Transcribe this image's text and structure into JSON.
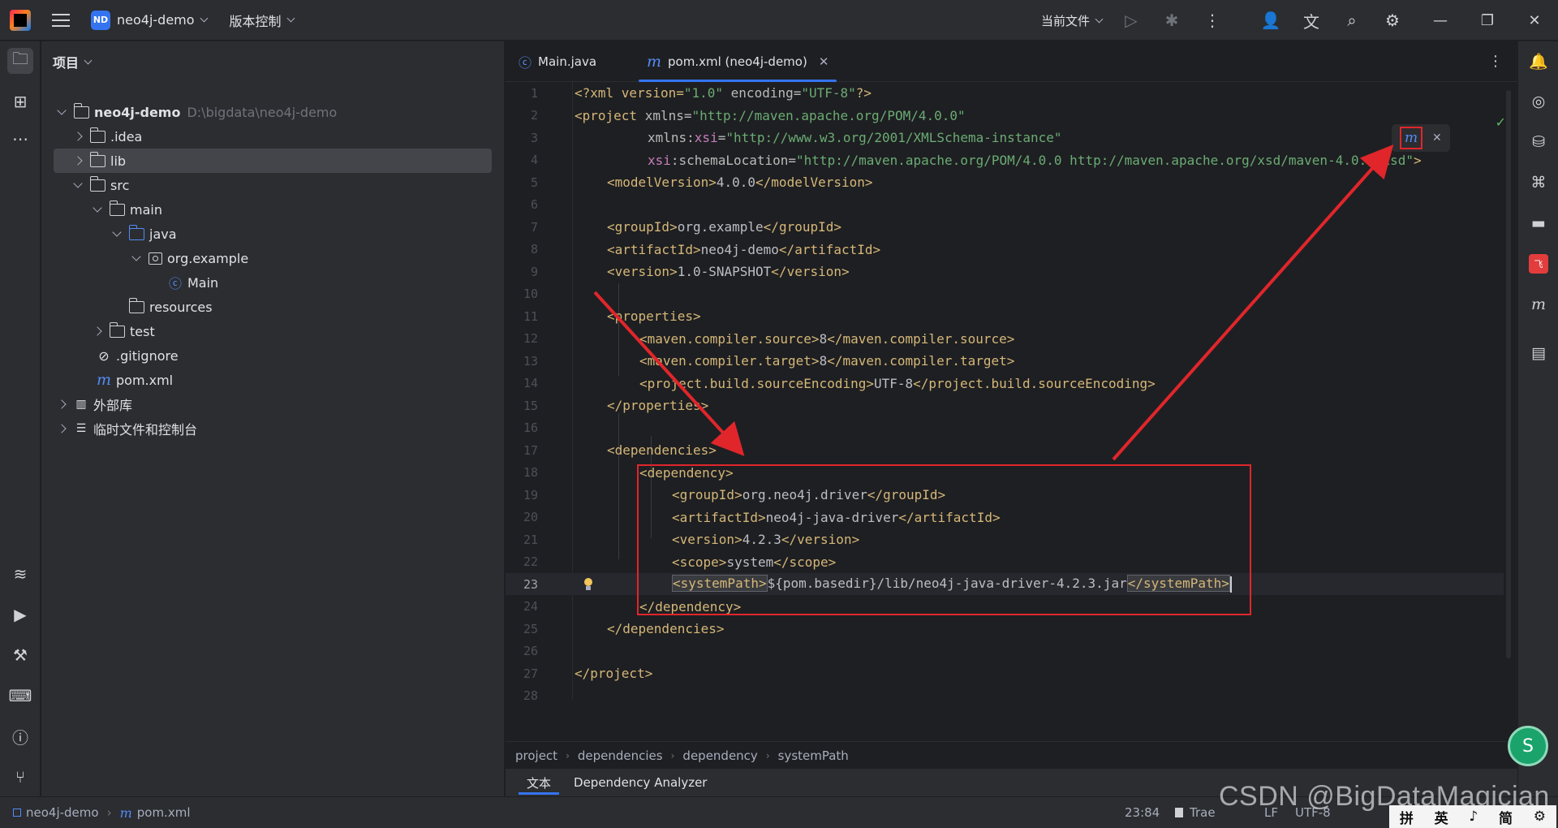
{
  "titlebar": {
    "project_badge": "ND",
    "project_name": "neo4j-demo",
    "vcs_label": "版本控制",
    "run_config": "当前文件"
  },
  "project_panel": {
    "title": "项目",
    "tree": [
      {
        "label": "neo4j-demo",
        "path": "D:\\bigdata\\neo4j-demo"
      },
      {
        "label": ".idea"
      },
      {
        "label": "lib"
      },
      {
        "label": "src"
      },
      {
        "label": "main"
      },
      {
        "label": "java"
      },
      {
        "label": "org.example"
      },
      {
        "label": "Main"
      },
      {
        "label": "resources"
      },
      {
        "label": "test"
      },
      {
        "label": ".gitignore"
      },
      {
        "label": "pom.xml"
      },
      {
        "label": "外部库"
      },
      {
        "label": "临时文件和控制台"
      }
    ]
  },
  "editor": {
    "tabs": [
      {
        "label": "Main.java",
        "icon": "java-class-icon"
      },
      {
        "label": "pom.xml (neo4j-demo)",
        "icon": "maven-icon",
        "active": true
      }
    ],
    "current_line": 23,
    "lines": [
      {
        "n": "1"
      },
      {
        "n": "2"
      },
      {
        "n": "3"
      },
      {
        "n": "4"
      },
      {
        "n": "5"
      },
      {
        "n": "6"
      },
      {
        "n": "7"
      },
      {
        "n": "8"
      },
      {
        "n": "9"
      },
      {
        "n": "10"
      },
      {
        "n": "11"
      },
      {
        "n": "12"
      },
      {
        "n": "13"
      },
      {
        "n": "14"
      },
      {
        "n": "15"
      },
      {
        "n": "16"
      },
      {
        "n": "17"
      },
      {
        "n": "18"
      },
      {
        "n": "19"
      },
      {
        "n": "20"
      },
      {
        "n": "21"
      },
      {
        "n": "22"
      },
      {
        "n": "23"
      },
      {
        "n": "24"
      },
      {
        "n": "25"
      },
      {
        "n": "26"
      },
      {
        "n": "27"
      },
      {
        "n": "28"
      }
    ],
    "code": {
      "l1_a": "<?xml version=",
      "l1_b": "\"1.0\"",
      "l1_c": " encoding=",
      "l1_d": "\"UTF-8\"",
      "l1_e": "?>",
      "l2_a": "<project",
      "l2_b": " xmlns=",
      "l2_c": "\"http://maven.apache.org/POM/4.0.0\"",
      "l3_a": "xmlns:",
      "l3_b": "xsi",
      "l3_c": "=",
      "l3_d": "\"http://www.w3.org/2001/XMLSchema-instance\"",
      "l4_a": "xsi",
      "l4_b": ":schemaLocation=",
      "l4_c": "\"http://maven.apache.org/POM/4.0.0 http://maven.apache.org/xsd/maven-4.0.0.xsd\"",
      "l4_d": ">",
      "l5_a": "<modelVersion>",
      "l5_b": "4.0.0",
      "l5_c": "</modelVersion>",
      "l7_a": "<groupId>",
      "l7_b": "org.example",
      "l7_c": "</groupId>",
      "l8_a": "<artifactId>",
      "l8_b": "neo4j-demo",
      "l8_c": "</artifactId>",
      "l9_a": "<version>",
      "l9_b": "1.0-SNAPSHOT",
      "l9_c": "</version>",
      "l11": "<properties>",
      "l12_a": "<maven.compiler.source>",
      "l12_b": "8",
      "l12_c": "</maven.compiler.source>",
      "l13_a": "<maven.compiler.target>",
      "l13_b": "8",
      "l13_c": "</maven.compiler.target>",
      "l14_a": "<project.build.sourceEncoding>",
      "l14_b": "UTF-8",
      "l14_c": "</project.build.sourceEncoding>",
      "l15": "</properties>",
      "l17": "<dependencies>",
      "l18": "<dependency>",
      "l19_a": "<groupId>",
      "l19_b": "org.neo4j.driver",
      "l19_c": "</groupId>",
      "l20_a": "<artifactId>",
      "l20_b": "neo4j-java-driver",
      "l20_c": "</artifactId>",
      "l21_a": "<version>",
      "l21_b": "4.2.3",
      "l21_c": "</version>",
      "l22_a": "<scope>",
      "l22_b": "system",
      "l22_c": "</scope>",
      "l23_a": "<systemPath>",
      "l23_b": "${pom.basedir}/lib/neo4j-java-driver-4.2.3.jar",
      "l23_c": "</systemPath>",
      "l24": "</dependency>",
      "l25": "</dependencies>",
      "l27": "</project>"
    },
    "breadcrumb": [
      "project",
      "dependencies",
      "dependency",
      "systemPath"
    ],
    "bottom_tabs": [
      "文本",
      "Dependency Analyzer"
    ]
  },
  "statusbar": {
    "project": "neo4j-demo",
    "file": "pom.xml",
    "position": "23:84",
    "plugin": "Trae",
    "line_sep": "LF",
    "encoding": "UTF-8"
  },
  "overlay": {
    "watermark": "CSDN @BigDataMagician",
    "ime": [
      "拼",
      "英",
      "♪",
      "简",
      "⚙"
    ],
    "annotation_color": "#e0262b"
  }
}
